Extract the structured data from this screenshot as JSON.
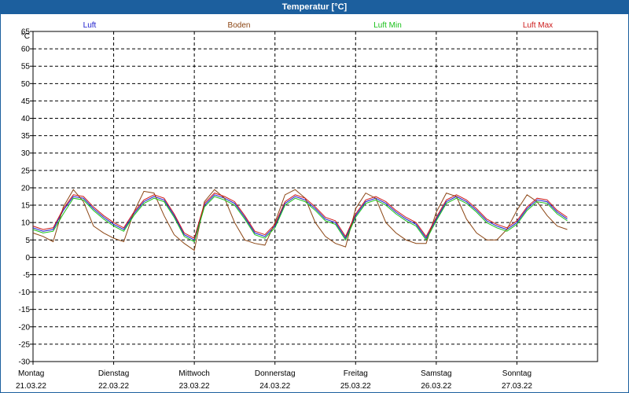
{
  "window": {
    "title": "Temperatur [°C]"
  },
  "chart_data": {
    "type": "line",
    "title": "Temperatur [°C]",
    "ylabel": "°C",
    "ylim": [
      -30,
      65
    ],
    "yticks": [
      65,
      60,
      55,
      50,
      45,
      40,
      35,
      30,
      25,
      20,
      15,
      10,
      5,
      0,
      -5,
      -10,
      -15,
      -20,
      -25,
      -30
    ],
    "grid": true,
    "legend_position": "top",
    "x_range": [
      0,
      7
    ],
    "day_labels": [
      {
        "day": "Montag",
        "date": "21.03.22"
      },
      {
        "day": "Dienstag",
        "date": "22.03.22"
      },
      {
        "day": "Mittwoch",
        "date": "23.03.22"
      },
      {
        "day": "Donnerstag",
        "date": "24.03.22"
      },
      {
        "day": "Freitag",
        "date": "25.03.22"
      },
      {
        "day": "Samstag",
        "date": "26.03.22"
      },
      {
        "day": "Sonntag",
        "date": "27.03.22"
      }
    ],
    "x": [
      0,
      0.125,
      0.25,
      0.375,
      0.5,
      0.625,
      0.75,
      0.875,
      1,
      1.125,
      1.25,
      1.375,
      1.5,
      1.625,
      1.75,
      1.875,
      2,
      2.125,
      2.25,
      2.375,
      2.5,
      2.625,
      2.75,
      2.875,
      3,
      3.125,
      3.25,
      3.375,
      3.5,
      3.625,
      3.75,
      3.875,
      4,
      4.125,
      4.25,
      4.375,
      4.5,
      4.625,
      4.75,
      4.875,
      5,
      5.125,
      5.25,
      5.375,
      5.5,
      5.625,
      5.75,
      5.875,
      6,
      6.125,
      6.25,
      6.375,
      6.5,
      6.625,
      6.75,
      6.875,
      7
    ],
    "series": [
      {
        "name": "Luft",
        "color": "#1a1acc",
        "values": [
          8.5,
          7.5,
          8,
          13.5,
          17.5,
          17,
          14,
          11.5,
          9.5,
          8,
          12.5,
          16,
          17.5,
          16.5,
          12,
          6.5,
          5,
          15,
          18,
          17,
          15.5,
          11.5,
          7,
          6,
          9,
          15.5,
          17.5,
          16.5,
          14,
          11,
          10,
          5.5,
          12,
          16,
          17,
          15.5,
          13,
          11,
          9.5,
          5.5,
          11,
          16,
          17.5,
          16,
          13.5,
          10.5,
          9,
          8,
          10,
          14,
          16.5,
          16,
          13,
          11
        ]
      },
      {
        "name": "Boden",
        "color": "#8b4513",
        "values": [
          7,
          6,
          4.5,
          14.5,
          19.5,
          16,
          9,
          7,
          5.5,
          4.5,
          13,
          19,
          18.5,
          12,
          6.5,
          4,
          2,
          16,
          19.5,
          17,
          10,
          5,
          4,
          3.5,
          10,
          18,
          19.5,
          17,
          10,
          6,
          4,
          3,
          14,
          18.5,
          17,
          10,
          7,
          5,
          4,
          4,
          13,
          18.5,
          17.5,
          11,
          7,
          5,
          5,
          8,
          13.5,
          18,
          16,
          12,
          9,
          8
        ]
      },
      {
        "name": "Luft Min",
        "color": "#18c018",
        "values": [
          8,
          7,
          7.5,
          12.5,
          17,
          16.5,
          13.5,
          11,
          9,
          7.5,
          12,
          15.5,
          17,
          16,
          11.5,
          6,
          4.5,
          14.5,
          17.5,
          16.5,
          15,
          11,
          6.5,
          5.5,
          8.5,
          15,
          17,
          16,
          13.5,
          10.5,
          9.5,
          5,
          11.5,
          15.5,
          16.5,
          15,
          12.5,
          10.5,
          9,
          5,
          10.5,
          15.5,
          17,
          15.5,
          13,
          10,
          8.5,
          7.5,
          9.5,
          13.5,
          16,
          15.5,
          12.5,
          10.5
        ]
      },
      {
        "name": "Luft Max",
        "color": "#cc1a1a",
        "values": [
          9,
          8,
          8.5,
          14,
          18,
          17.5,
          14.5,
          12,
          10,
          8.5,
          13,
          16.5,
          18,
          17,
          12.5,
          7,
          5.5,
          15.5,
          18.5,
          17.5,
          16,
          12,
          7.5,
          6.5,
          9.5,
          16,
          18,
          17,
          14.5,
          11.5,
          10.5,
          6,
          12.5,
          16.5,
          17.5,
          16,
          13.5,
          11.5,
          10,
          6,
          11.5,
          16.5,
          18,
          16.5,
          14,
          11,
          9.5,
          8.5,
          10.5,
          14.5,
          17,
          16.5,
          13.5,
          11.5
        ]
      }
    ]
  }
}
